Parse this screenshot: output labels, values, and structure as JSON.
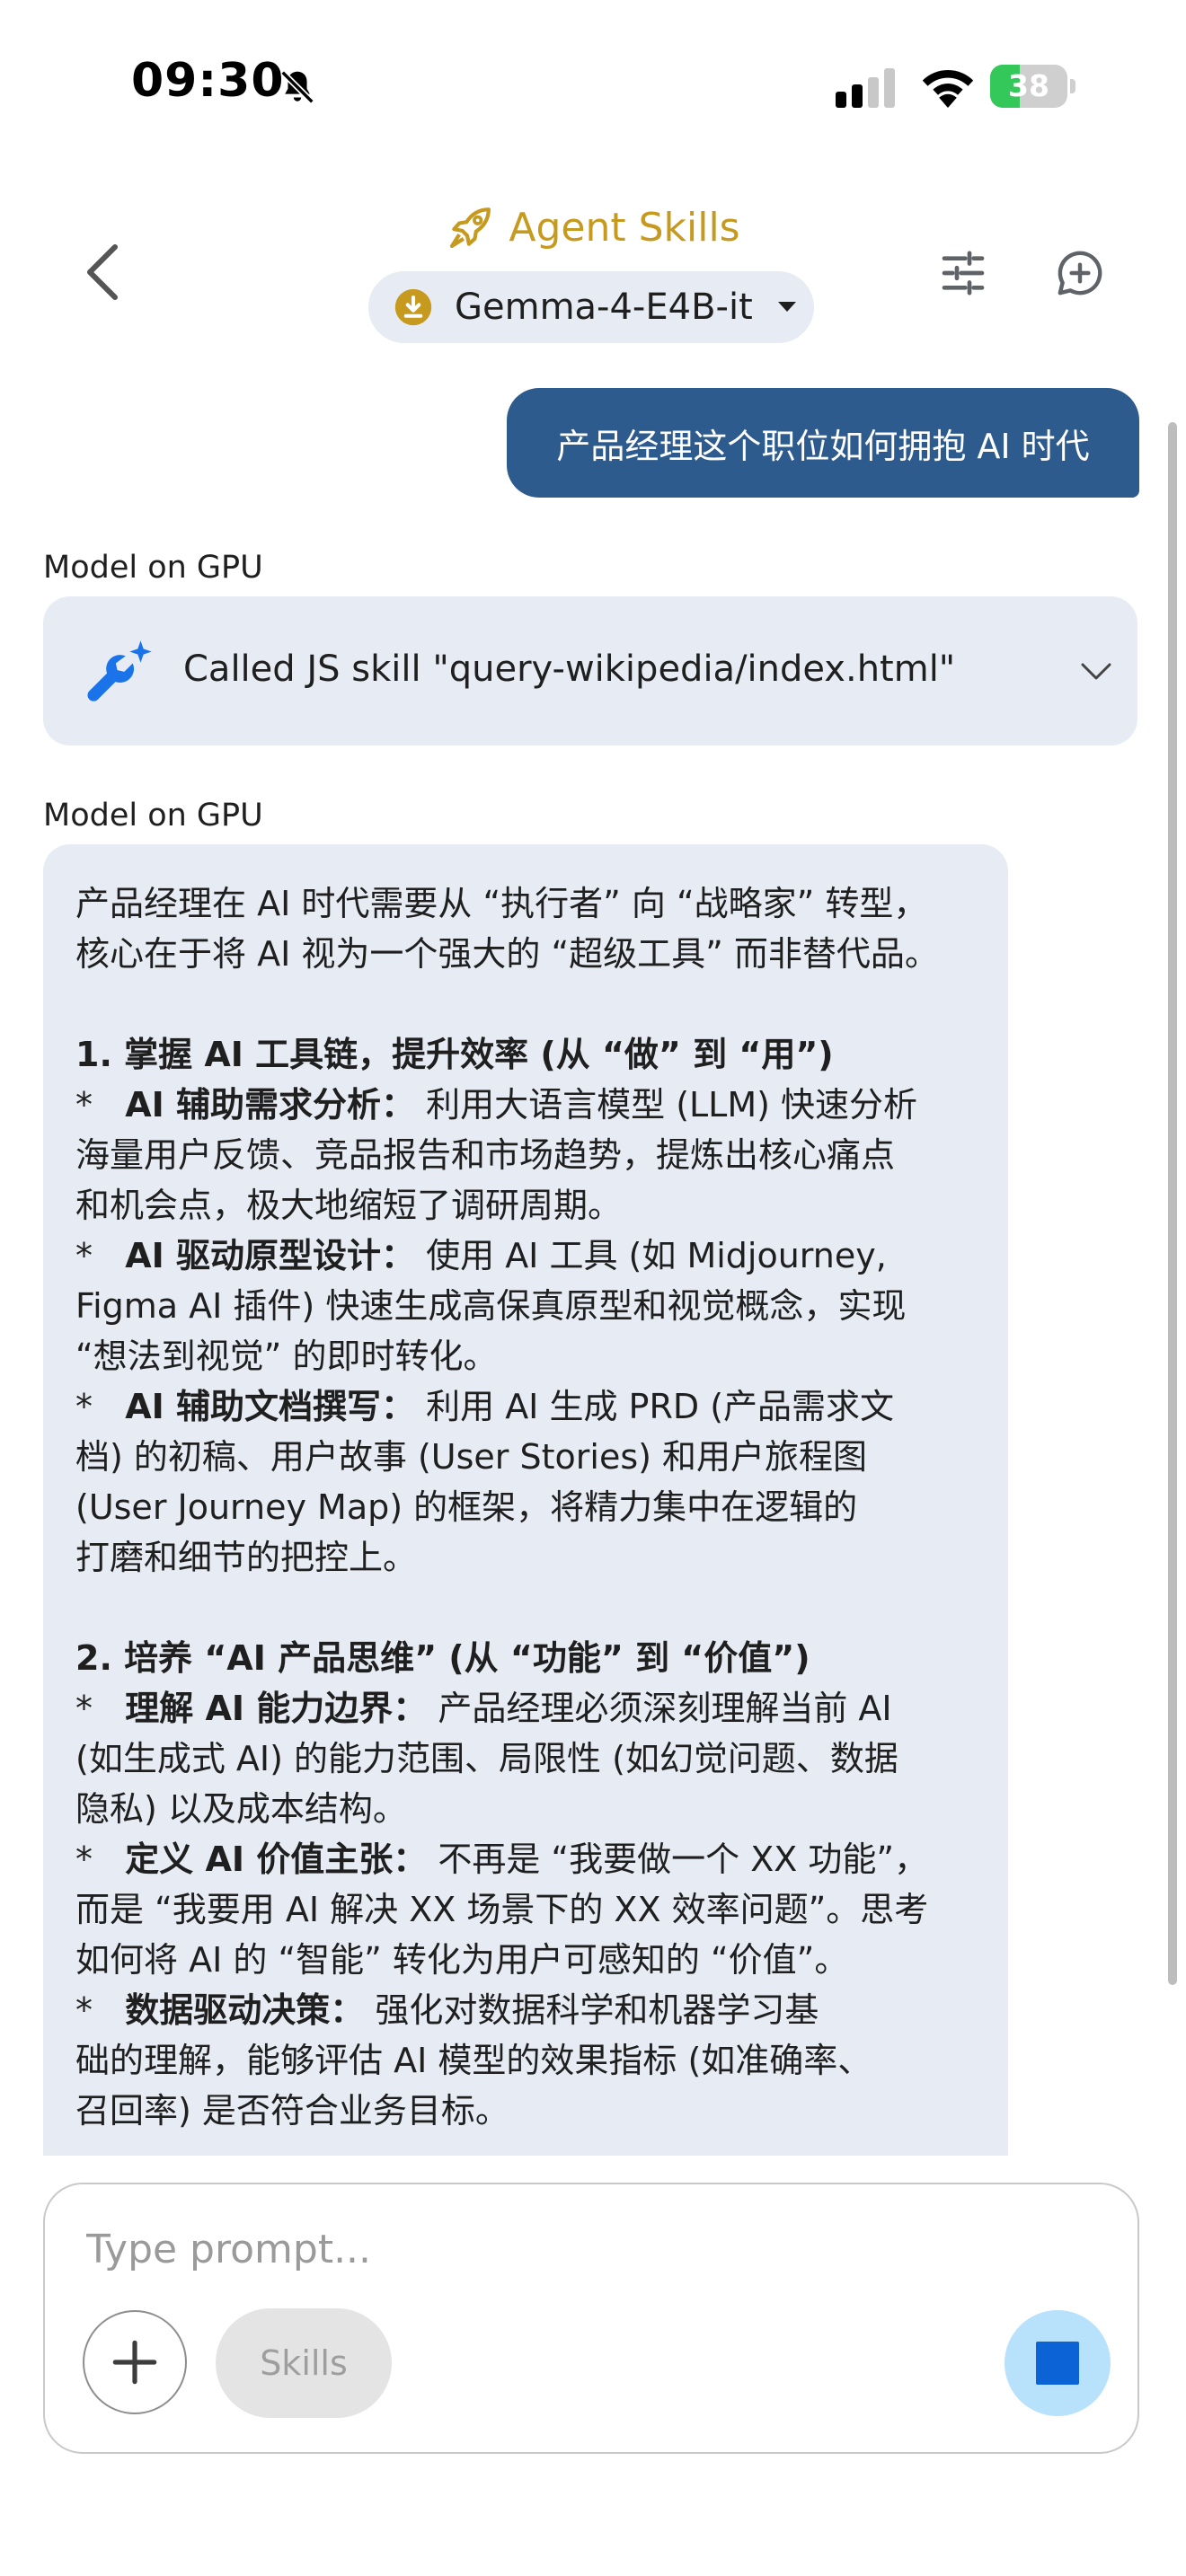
{
  "status_bar": {
    "time": "09:30",
    "battery_level": "38",
    "battery_fraction": 0.38,
    "icons": [
      "bell-slash-icon",
      "cellular-signal-icon",
      "wifi-icon",
      "battery-charging-icon"
    ]
  },
  "header": {
    "title": "Agent Skills",
    "model_name": "Gemma-4-E4B-it",
    "icons": [
      "back-arrow-icon",
      "rocket-icon",
      "download-icon",
      "caret-down-icon",
      "tune-icon",
      "new-chat-icon"
    ]
  },
  "chat": {
    "user_message": "产品经理这个职位如何拥抱 AI 时代",
    "skill_call": {
      "sender": "Model on GPU",
      "text": "Called JS skill \"query-wikipedia/index.html\""
    },
    "response": {
      "sender": "Model on GPU",
      "lines": [
        {
          "text": "产品经理在 AI 时代需要从 “执行者” 向 “战略家” 转型，"
        },
        {
          "text": "核心在于将 AI 视为一个强大的 “超级工具” 而非替代品。"
        },
        {
          "text": ""
        },
        {
          "text": "1. 掌握 AI 工具链，提升效率 (从 “做” 到 “用”)",
          "bold": true
        },
        {
          "prefix": "*   ",
          "label": "AI 辅助需求分析：",
          "text": " 利用大语言模型 (LLM) 快速分析"
        },
        {
          "text": "海量用户反馈、竞品报告和市场趋势，提炼出核心痛点"
        },
        {
          "text": "和机会点，极大地缩短了调研周期。"
        },
        {
          "prefix": "*   ",
          "label": "AI 驱动原型设计：",
          "text": " 使用 AI 工具 (如 Midjourney,"
        },
        {
          "text": "Figma AI 插件) 快速生成高保真原型和视觉概念，实现"
        },
        {
          "text": "“想法到视觉” 的即时转化。"
        },
        {
          "prefix": "*   ",
          "label": "AI 辅助文档撰写：",
          "text": " 利用 AI 生成 PRD (产品需求文"
        },
        {
          "text": "档) 的初稿、用户故事 (User Stories) 和用户旅程图"
        },
        {
          "text": "(User Journey Map) 的框架，将精力集中在逻辑的"
        },
        {
          "text": "打磨和细节的把控上。"
        },
        {
          "text": ""
        },
        {
          "text": "2. 培养 “AI 产品思维” (从 “功能” 到 “价值”)",
          "bold": true
        },
        {
          "prefix": "*   ",
          "label": "理解 AI 能力边界：",
          "text": " 产品经理必须深刻理解当前 AI"
        },
        {
          "text": "(如生成式 AI) 的能力范围、局限性 (如幻觉问题、数据"
        },
        {
          "text": "隐私) 以及成本结构。"
        },
        {
          "prefix": "*   ",
          "label": "定义 AI 价值主张：",
          "text": " 不再是 “我要做一个 XX 功能”，"
        },
        {
          "text": "而是 “我要用 AI 解决 XX 场景下的 XX 效率问题”。思考"
        },
        {
          "text": "如何将 AI 的 “智能” 转化为用户可感知的 “价值”。"
        },
        {
          "prefix": "*   ",
          "label": "数据驱动决策：",
          "text": " 强化对数据科学和机器学习基"
        },
        {
          "text": "础的理解，能够评估 AI 模型的效果指标 (如准确率、"
        },
        {
          "text": "召回率) 是否符合业务目标。"
        }
      ]
    }
  },
  "input": {
    "placeholder": "Type prompt...",
    "value": "",
    "skills_label": "Skills",
    "icons": [
      "plus-icon",
      "stop-icon"
    ]
  },
  "colors": {
    "title_gold": "#c69a1e",
    "user_bubble": "#2e5b8d",
    "card_bg": "#e7ebf3",
    "accent_blue": "#1a73e8",
    "battery_green": "#34c759",
    "stop_bg": "#b8e1fb",
    "stop_square": "#0b63d6"
  }
}
